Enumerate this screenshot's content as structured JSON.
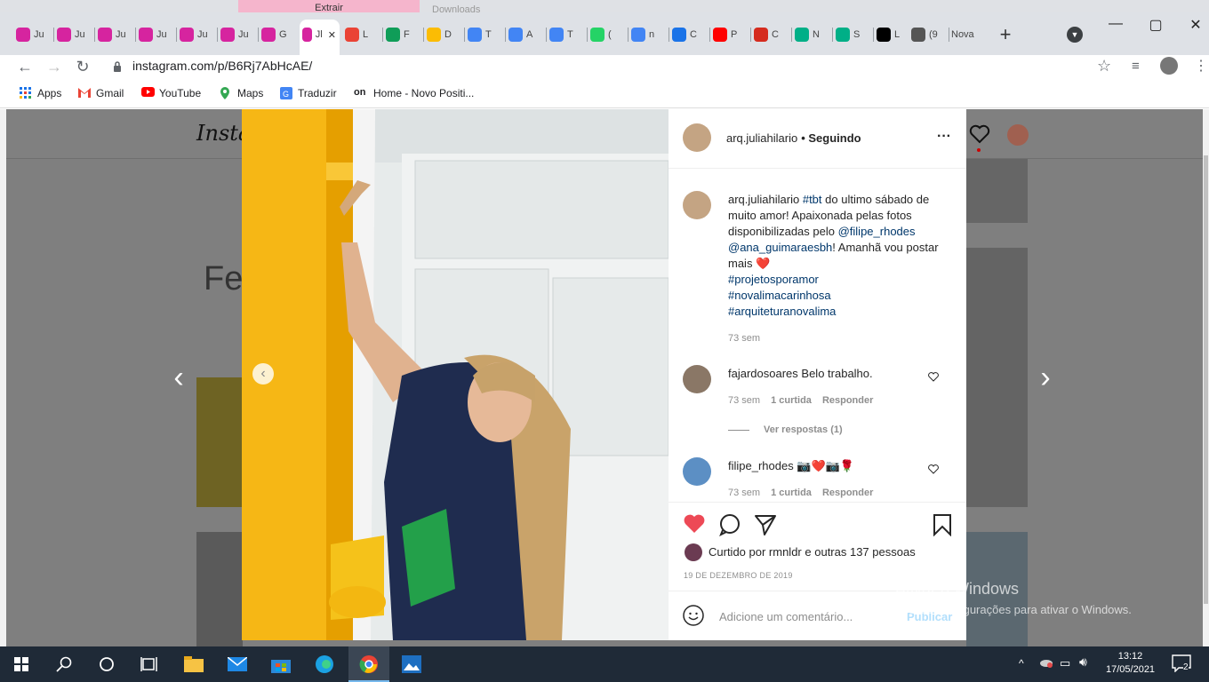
{
  "window": {
    "top_title": "Extrair",
    "downloads_label": "Downloads",
    "controls": {
      "minimize": "—",
      "maximize": "▢",
      "close": "✕"
    }
  },
  "tabs": [
    {
      "label": "Ju",
      "icon": "instagram-icon",
      "color": "#d6249f"
    },
    {
      "label": "Ju",
      "icon": "instagram-icon",
      "color": "#d6249f"
    },
    {
      "label": "Ju",
      "icon": "instagram-icon",
      "color": "#d6249f"
    },
    {
      "label": "Ju",
      "icon": "instagram-icon",
      "color": "#d6249f"
    },
    {
      "label": "Ju",
      "icon": "instagram-icon",
      "color": "#d6249f"
    },
    {
      "label": "Ju",
      "icon": "instagram-icon",
      "color": "#d6249f"
    },
    {
      "label": "G",
      "icon": "instagram-icon",
      "color": "#d6249f"
    },
    {
      "label": "Jl",
      "icon": "instagram-icon",
      "color": "#d6249f",
      "active": true
    },
    {
      "label": "L",
      "icon": "gmail-icon",
      "color": "#ea4335"
    },
    {
      "label": "F",
      "icon": "drive-icon",
      "color": "#0f9d58"
    },
    {
      "label": "D",
      "icon": "calendar-icon",
      "color": "#fbbc04"
    },
    {
      "label": "T",
      "icon": "circle-c-icon",
      "color": "#4285f4"
    },
    {
      "label": "A",
      "icon": "circle-c-icon",
      "color": "#4285f4"
    },
    {
      "label": "T",
      "icon": "circle-c-icon",
      "color": "#4285f4"
    },
    {
      "label": "(",
      "icon": "whatsapp-icon",
      "color": "#25d366"
    },
    {
      "label": "n",
      "icon": "google-icon",
      "color": "#4285f4"
    },
    {
      "label": "C",
      "icon": "layers-icon",
      "color": "#1a73e8"
    },
    {
      "label": "P",
      "icon": "yandex-icon",
      "color": "#ff0000"
    },
    {
      "label": "C",
      "icon": "chile-flag-icon",
      "color": "#d52b1e"
    },
    {
      "label": "N",
      "icon": "tripadvisor-icon",
      "color": "#00af87"
    },
    {
      "label": "S",
      "icon": "tripadvisor-icon",
      "color": "#00af87"
    },
    {
      "label": "L",
      "icon": "x-icon",
      "color": "#000000"
    },
    {
      "label": "(9",
      "icon": "speaker-icon",
      "color": "#555555"
    },
    {
      "label": "Nova",
      "icon": "none",
      "color": "#555555"
    }
  ],
  "address": {
    "url": "instagram.com/p/B6Rj7AbHcAE/"
  },
  "bookmarks": [
    {
      "label": "Apps",
      "icon": "apps-grid-icon"
    },
    {
      "label": "Gmail",
      "icon": "gmail-icon"
    },
    {
      "label": "YouTube",
      "icon": "youtube-icon"
    },
    {
      "label": "Maps",
      "icon": "maps-pin-icon"
    },
    {
      "label": "Traduzir",
      "icon": "translate-icon"
    },
    {
      "label": "Home - Novo Positi...",
      "icon": "on-icon"
    }
  ],
  "instagram": {
    "logo": "Insta",
    "bg_heading": "Fe"
  },
  "post": {
    "author": "arq.juliahilario",
    "following": "• Seguindo",
    "more": "···",
    "caption": {
      "username": "arq.juliahilario",
      "hashtag1": "#tbt",
      "text1": " do ultimo sábado de muito amor! Apaixonada pelas fotos disponibilizadas pelo ",
      "mention1": "@filipe_rhodes",
      "mention2": "@ana_guimaraesbh",
      "text2": "! Amanhã vou postar mais ",
      "heart": "❤️",
      "tags": [
        "#projetosporamor",
        "#novalimacarinhosa",
        "#arquiteturanovalima"
      ],
      "age": "73 sem"
    },
    "comments": [
      {
        "username": "fajardosoares",
        "text": "Belo trabalho.",
        "age": "73 sem",
        "likes": "1 curtida",
        "reply": "Responder",
        "view_replies": "Ver respostas (1)"
      },
      {
        "username": "filipe_rhodes",
        "text": "📷❤️📷🌹",
        "age": "73 sem",
        "likes": "1 curtida",
        "reply": "Responder"
      }
    ],
    "liked_by_prefix": "Curtido por ",
    "liked_by_user": "rmnldr",
    "liked_by_and": " e ",
    "liked_by_others": "outras 137 pessoas",
    "date": "19 DE DEZEMBRO DE 2019",
    "comment_placeholder": "Adicione um comentário...",
    "publish": "Publicar"
  },
  "activation": {
    "title": "Ativar o Windows",
    "subtitle": "Acesse Configurações para ativar o Windows."
  },
  "taskbar": {
    "time": "13:12",
    "date": "17/05/2021",
    "notifications": "2"
  }
}
